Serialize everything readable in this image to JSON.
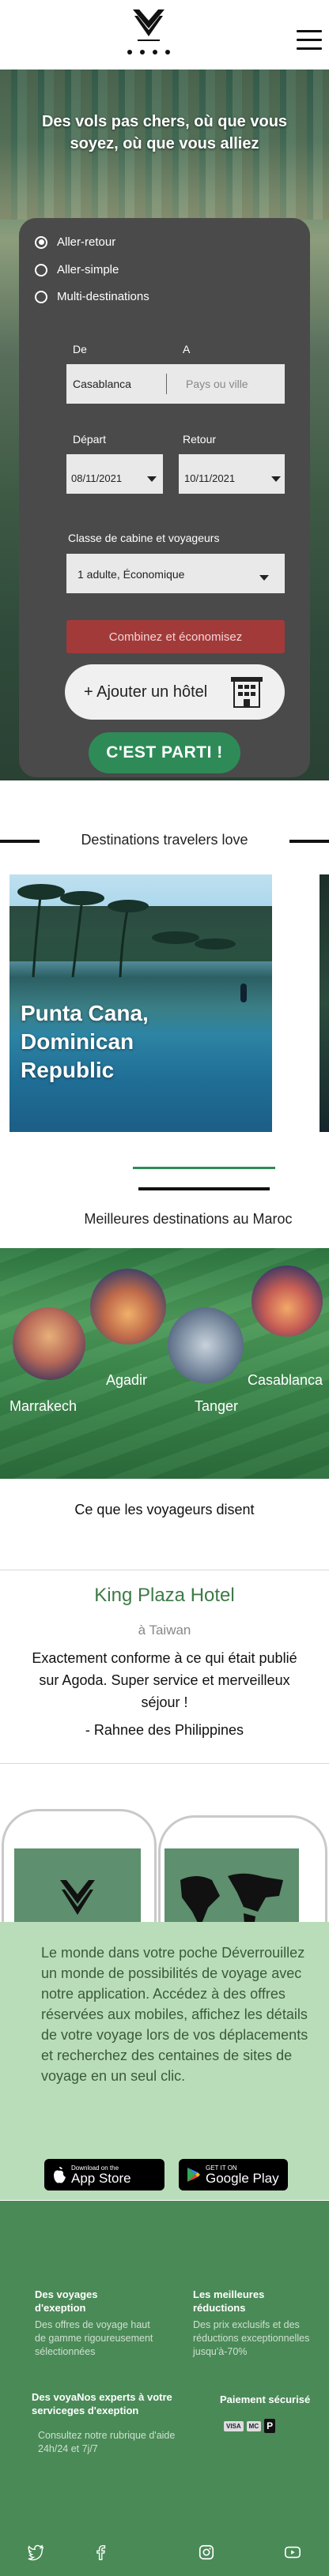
{
  "hero": {
    "title": "Des vols pas chers, où que vous soyez, où que vous alliez"
  },
  "search": {
    "trip_types": [
      "Aller-retour",
      "Aller-simple",
      "Multi-destinations"
    ],
    "selected_trip_type": "Aller-retour",
    "from_label": "De",
    "to_label": "A",
    "from_value": "Casablanca",
    "to_placeholder": "Pays ou ville",
    "depart_label": "Départ",
    "return_label": "Retour",
    "depart_value": "08/11/2021",
    "return_value": "10/11/2021",
    "cabin_label": "Classe de cabine et voyageurs",
    "cabin_value": "1 adulte, Économique",
    "combine_button": "Combinez et économisez",
    "hotel_button": "+ Ajouter un hôtel",
    "go_button": "C'EST PARTI !"
  },
  "destinations": {
    "title": "Destinations travelers love",
    "cards": [
      {
        "name": "Punta Cana, Dominican Republic"
      }
    ]
  },
  "maroc": {
    "title": "Meilleures destinations au Maroc",
    "cities": [
      "Marrakech",
      "Agadir",
      "Tanger",
      "Casablanca"
    ]
  },
  "testimonials": {
    "title": "Ce que les voyageurs disent",
    "hotel": "King Plaza Hotel",
    "location": "à Taiwan",
    "text": "Exactement conforme à ce qui était publié sur Agoda. Super service et merveilleux séjour !",
    "author": "- Rahnee des Philippines"
  },
  "app": {
    "text": "Le monde dans votre poche Déverrouillez un monde de possibilités de voyage avec notre application. Accédez à des offres réservées aux mobiles, affichez les détails de votre voyage lors de vos déplacements et recherchez des centaines de sites de voyage en un seul clic.",
    "app_store_small": "Download on the",
    "app_store_big": "App Store",
    "google_small": "GET IT ON",
    "google_big": "Google Play"
  },
  "footer": {
    "col1_title": "Des voyages d'exeption",
    "col1_text": "Des offres de voyage haut de gamme rigoureusement sélectionnées",
    "col2_title": "Les meilleures réductions",
    "col2_text": "Des prix exclusifs et des réductions exceptionnelles jusqu'à-70%",
    "col3_title": "Des voyaNos experts à votre serviceges d'exeption",
    "col3_text": "Consultez notre rubrique d'aide 24h/24 et 7j/7",
    "col4_title": "Paiement sécurisé",
    "payments": [
      "VISA",
      "MC",
      "P"
    ]
  },
  "colors": {
    "accent_green": "#2e8b57",
    "card_gray": "#4a4a4a",
    "combine_red": "#a33a3a",
    "footer_green": "#4a8a57",
    "app_band": "#b9ddb9"
  }
}
